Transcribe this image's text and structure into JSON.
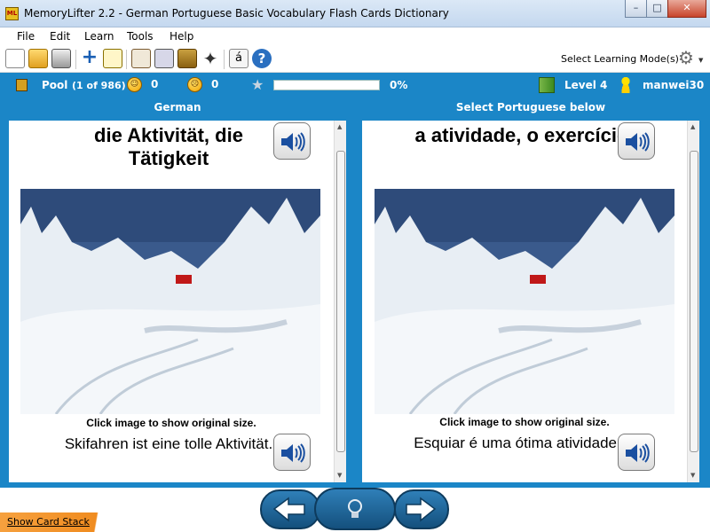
{
  "window": {
    "title": "MemoryLifter 2.2 - German Portuguese Basic Vocabulary Flash Cards Dictionary",
    "app_icon_text": "ML"
  },
  "menu": {
    "items": [
      "File",
      "Edit",
      "Learn",
      "Tools",
      "Help"
    ]
  },
  "toolbar": {
    "select_mode_label": "Select Learning Mode(s)",
    "char_button": "á"
  },
  "status": {
    "pool_label": "Pool",
    "pool_count": "(1 of 986)",
    "correct_count": "0",
    "wrong_count": "0",
    "progress_text": "0%",
    "progress": 0,
    "level": "Level 4",
    "user": "manwei30"
  },
  "question": {
    "header": "German",
    "word": "die Aktivität, die Tätigkeit",
    "caption": "Click image to show original size.",
    "sentence": "Skifahren ist eine tolle Aktivität."
  },
  "answer": {
    "header": "Select Portuguese below",
    "word": "a atividade, o exercício",
    "caption": "Click image to show original size.",
    "sentence": "Esquiar é uma ótima atividade."
  },
  "footer": {
    "show_card_stack": "Show Card Stack"
  },
  "colors": {
    "accent": "#1b86c7",
    "orange": "#f08c20"
  }
}
